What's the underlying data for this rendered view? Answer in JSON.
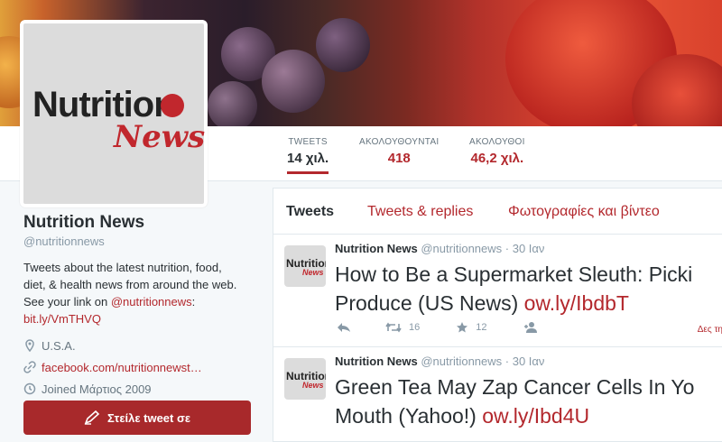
{
  "profile": {
    "name": "Nutrition News",
    "handle": "@nutritionnews",
    "bio_line1": "Tweets about the latest nutrition, food,",
    "bio_line2": "diet, & health news from around the web.",
    "bio_line3_prefix": "See your link on ",
    "bio_mention": "@nutritionnews",
    "bio_line3_suffix": ":",
    "bio_link": "bit.ly/VmTHVQ",
    "location": "U.S.A.",
    "website": "facebook.com/nutritionnewst…",
    "joined": "Joined Μάρτιος 2009",
    "logo_word": "Nutrition",
    "logo_news": "News",
    "tweet_button": "Στείλε tweet σε"
  },
  "stats": [
    {
      "label": "TWEETS",
      "value": "14 χιλ."
    },
    {
      "label": "ΑΚΟΛΟΥΘΟΥΝΤΑΙ",
      "value": "418"
    },
    {
      "label": "ΑΚΟΛΟΥΘΟΙ",
      "value": "46,2 χιλ."
    }
  ],
  "tabs": [
    {
      "label": "Tweets"
    },
    {
      "label": "Tweets & replies"
    },
    {
      "label": "Φωτογραφίες και βίντεο"
    }
  ],
  "tweets": [
    {
      "name": "Nutrition News",
      "handle": "@nutritionnews",
      "time": "· 30 Ιαν",
      "line1": "How to Be a Supermarket Sleuth: Picki",
      "line2_text": "Produce (US News) ",
      "line2_link": "ow.ly/IbdbT",
      "retweets": "16",
      "favorites": "12",
      "more": "Δες τη"
    },
    {
      "name": "Nutrition News",
      "handle": "@nutritionnews",
      "time": "· 30 Ιαν",
      "line1": "Green Tea May Zap Cancer Cells In Yo",
      "line2_text": "Mouth (Yahoo!) ",
      "line2_link": "ow.ly/Ibd4U"
    }
  ],
  "colors": {
    "accent": "#b3282d",
    "button": "#a8292b"
  },
  "icons": [
    "location-pin-icon",
    "link-icon",
    "calendar-icon",
    "reply-icon",
    "retweet-icon",
    "favorite-icon",
    "follow-icon",
    "compose-icon"
  ]
}
